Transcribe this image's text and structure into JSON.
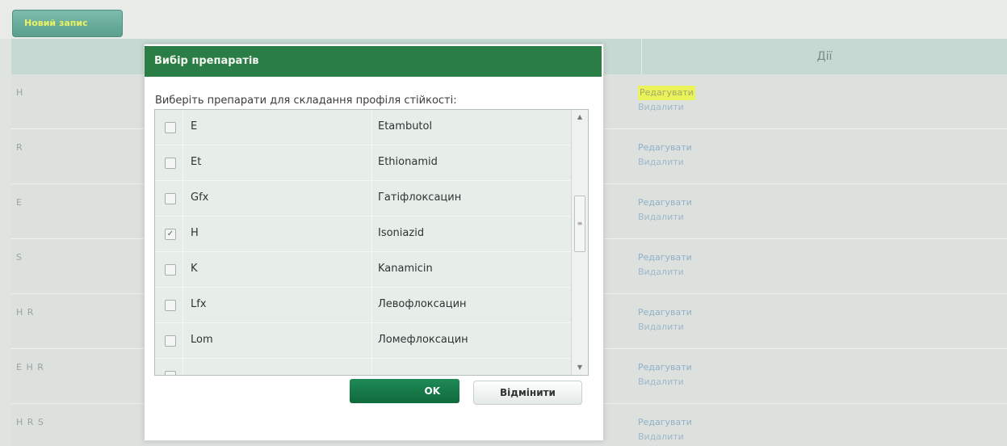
{
  "page": {
    "new_record_button": "Новий запис",
    "actions_header": "Дії",
    "rows": [
      {
        "code": "H",
        "edit": "Редагувати",
        "delete": "Видалити",
        "highlight": true
      },
      {
        "code": "R",
        "edit": "Редагувати",
        "delete": "Видалити"
      },
      {
        "code": "E",
        "edit": "Редагувати",
        "delete": "Видалити"
      },
      {
        "code": "S",
        "edit": "Редагувати",
        "delete": "Видалити"
      },
      {
        "code": "H R",
        "edit": "Редагувати",
        "delete": "Видалити"
      },
      {
        "code": "E H R",
        "edit": "Редагувати",
        "delete": "Видалити"
      },
      {
        "code": "H R S",
        "edit": "Редагувати",
        "delete": "Видалити"
      }
    ]
  },
  "dialog": {
    "title": "Вибір препаратів",
    "prompt": "Виберіть препарати для складання профіля стійкості:",
    "items": [
      {
        "abbr": "E",
        "name": "Etambutol",
        "checked": false
      },
      {
        "abbr": "Et",
        "name": "Ethionamid",
        "checked": false
      },
      {
        "abbr": "Gfx",
        "name": "Гатіфлоксацин",
        "checked": false
      },
      {
        "abbr": "H",
        "name": "Isoniazid",
        "checked": true
      },
      {
        "abbr": "K",
        "name": "Kanamicin",
        "checked": false
      },
      {
        "abbr": "Lfx",
        "name": "Левофлоксацин",
        "checked": false
      },
      {
        "abbr": "Lom",
        "name": "Ломефлоксацин",
        "checked": false
      }
    ],
    "ok_label": "OK",
    "cancel_label": "Відмінити"
  },
  "colors": {
    "title_bar": "#2a7d45",
    "ok_button": "#0f6a3c",
    "highlight": "#eaf25a"
  }
}
